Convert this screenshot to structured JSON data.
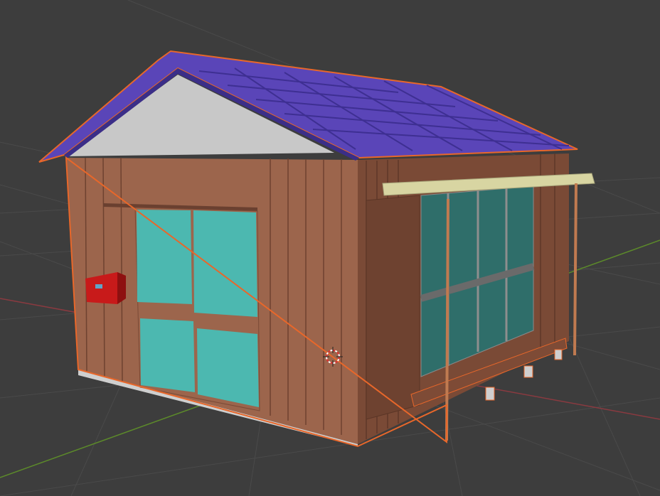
{
  "viewport": {
    "colors": {
      "background": "#3d3d3d",
      "grid": "#4a4a4a",
      "x_axis": "#8a3a40",
      "y_axis": "#5c8a2a",
      "selection_outline": "#e8672a",
      "roof": "#5a45b8",
      "wall": "#9c654c",
      "glass": "#4cb8b0",
      "mailbox": "#c81a1a",
      "awning": "#d8d5a2"
    }
  }
}
